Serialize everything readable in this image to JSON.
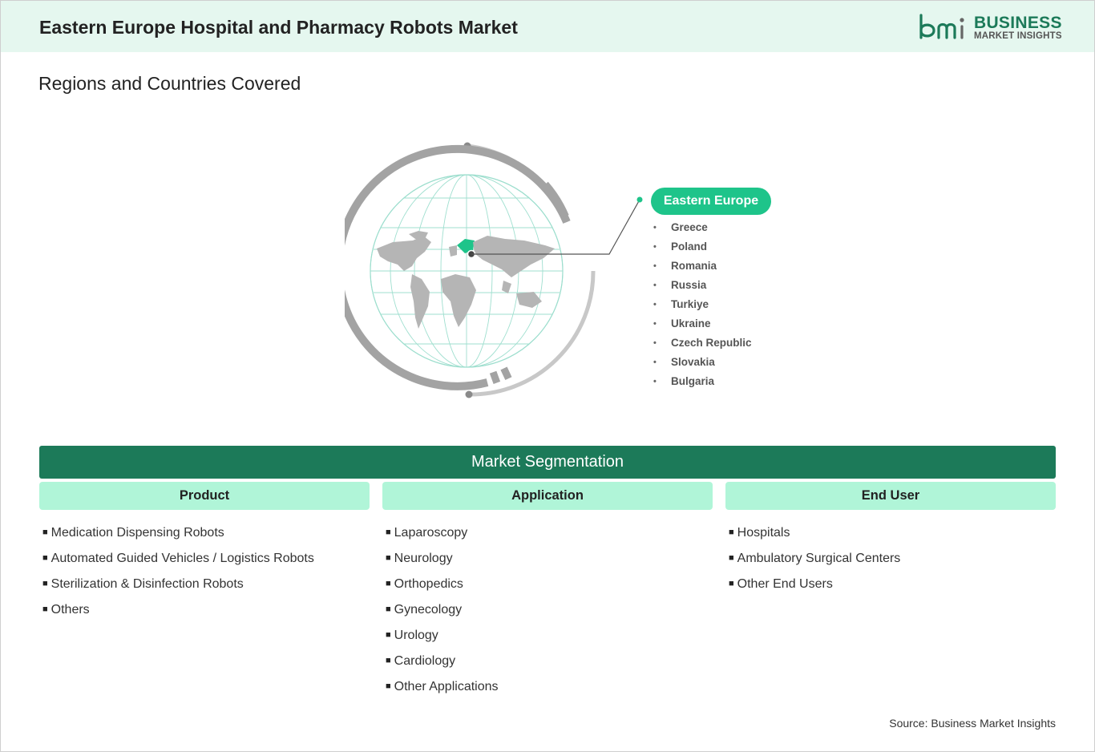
{
  "header": {
    "title": "Eastern Europe Hospital and Pharmacy Robots Market",
    "logo": {
      "mark": "bmi",
      "line1": "BUSINESS",
      "line2": "MARKET INSIGHTS"
    }
  },
  "regions": {
    "heading": "Regions and Countries Covered",
    "region_name": "Eastern Europe",
    "countries": [
      "Greece",
      "Poland",
      "Romania",
      "Russia",
      "Turkiye",
      "Ukraine",
      "Czech Republic",
      "Slovakia",
      "Bulgaria"
    ]
  },
  "segmentation": {
    "title": "Market Segmentation",
    "columns": [
      {
        "heading": "Product",
        "items": [
          "Medication Dispensing Robots",
          "Automated Guided Vehicles / Logistics Robots",
          "Sterilization & Disinfection Robots",
          "Others"
        ]
      },
      {
        "heading": "Application",
        "items": [
          "Laparoscopy",
          "Neurology",
          "Orthopedics",
          "Gynecology",
          "Urology",
          "Cardiology",
          "Other Applications"
        ]
      },
      {
        "heading": "End User",
        "items": [
          "Hospitals",
          "Ambulatory Surgical Centers",
          "Other End Users"
        ]
      }
    ]
  },
  "source": "Source: Business Market Insights",
  "colors": {
    "brand_green": "#1c7a59",
    "accent_green": "#1ec48a",
    "header_bg": "#e5f7ef",
    "column_header_bg": "#b0f5d8"
  }
}
